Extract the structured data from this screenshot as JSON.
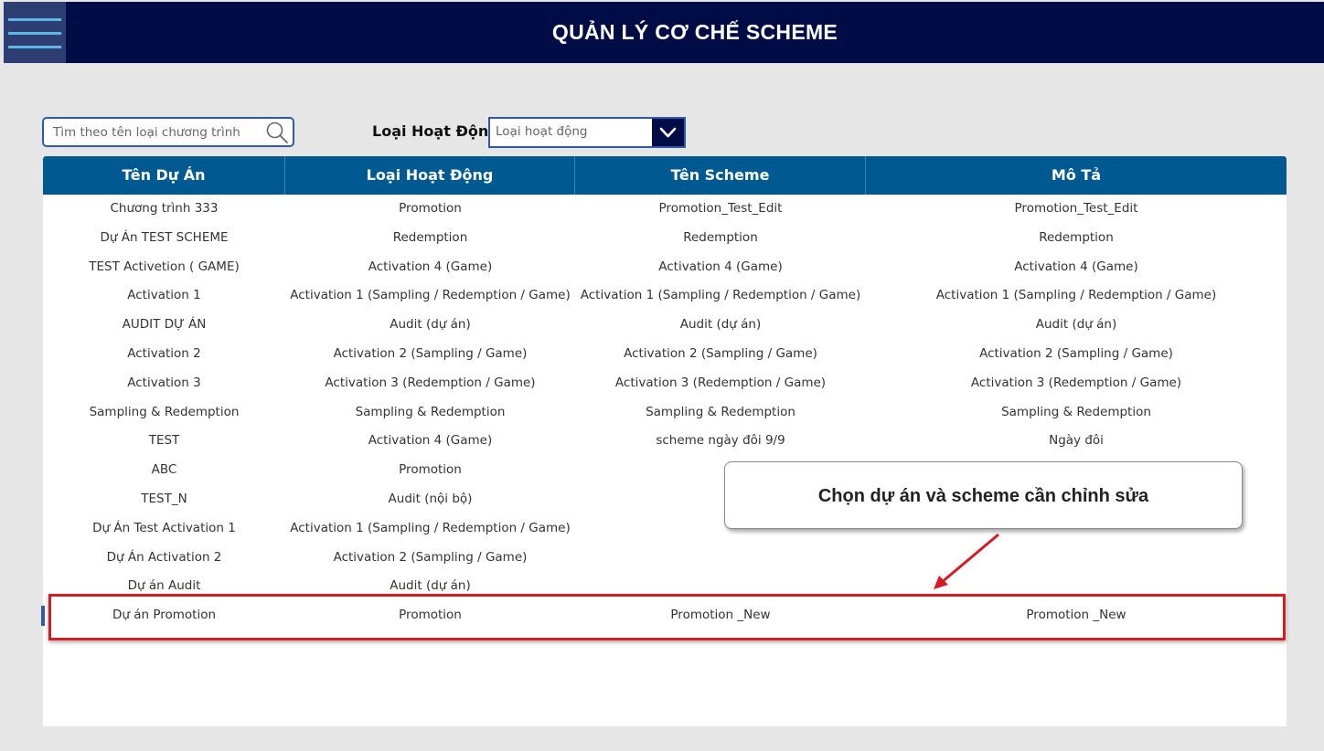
{
  "header": {
    "title": "QUẢN LÝ CƠ CHẾ SCHEME"
  },
  "filters": {
    "search_placeholder": "Tìm theo tên loại chương trình",
    "activity_label": "Loại Hoạt Động",
    "activity_select_value": "Loại hoạt động"
  },
  "table": {
    "columns": [
      "Tên Dự Án",
      "Loại Hoạt Động",
      "Tên Scheme",
      "Mô Tả"
    ],
    "rows": [
      [
        "Chương trình 333",
        "Promotion",
        "Promotion_Test_Edit",
        "Promotion_Test_Edit"
      ],
      [
        "Dự Án TEST SCHEME",
        "Redemption",
        "Redemption",
        "Redemption"
      ],
      [
        "TEST Activetion ( GAME)",
        "Activation 4 (Game)",
        "Activation 4 (Game)",
        "Activation 4 (Game)"
      ],
      [
        "Activation 1",
        "Activation 1 (Sampling / Redemption / Game)",
        "Activation 1 (Sampling / Redemption / Game)",
        "Activation 1 (Sampling / Redemption / Game)"
      ],
      [
        "AUDIT DỰ ÁN",
        "Audit (dự án)",
        "Audit (dự án)",
        "Audit (dự án)"
      ],
      [
        "Activation 2",
        "Activation 2 (Sampling / Game)",
        "Activation 2 (Sampling / Game)",
        "Activation 2 (Sampling / Game)"
      ],
      [
        "Activation 3",
        "Activation 3 (Redemption / Game)",
        "Activation 3 (Redemption / Game)",
        "Activation 3 (Redemption / Game)"
      ],
      [
        "Sampling & Redemption",
        "Sampling & Redemption",
        "Sampling & Redemption",
        "Sampling & Redemption"
      ],
      [
        "TEST",
        "Activation 4 (Game)",
        "scheme ngày đôi 9/9",
        "Ngày đôi"
      ],
      [
        "ABC",
        "Promotion",
        "",
        ""
      ],
      [
        "TEST_N",
        "Audit (nội bộ)",
        "",
        ""
      ],
      [
        "Dự Án Test Activation 1",
        "Activation 1 (Sampling / Redemption / Game)",
        "",
        ""
      ],
      [
        "Dự Án Activation 2",
        "Activation 2 (Sampling / Game)",
        "",
        ""
      ],
      [
        "Dự án Audit",
        "Audit (dự án)",
        "",
        ""
      ],
      [
        "Dự án Promotion",
        "Promotion",
        "Promotion _New",
        "Promotion _New"
      ]
    ],
    "selected_row": 14
  },
  "callout": {
    "text": "Chọn dự án và scheme cần chỉnh sửa"
  },
  "colors": {
    "header_bg": "#000c45",
    "table_header_bg": "#005a91",
    "highlight": "#d41c24"
  },
  "icons": {
    "menu": "hamburger-menu-icon",
    "search": "search-icon",
    "dropdown": "chevron-down-icon"
  }
}
